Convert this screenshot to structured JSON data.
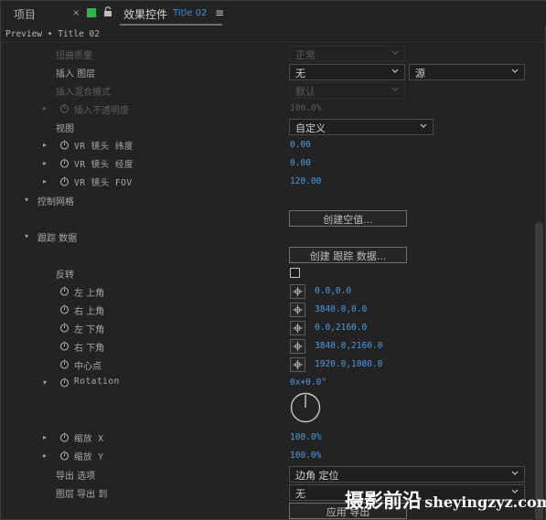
{
  "tabs": {
    "project": "项目",
    "close": "×",
    "effect_controls": "效果控件",
    "effect_controls_sub": "Title 02",
    "menu": "≡"
  },
  "breadcrumb": "Preview • Title 02",
  "props": {
    "distortion_quality": {
      "label": "扭曲质量",
      "value": "正常"
    },
    "inset_layer": {
      "label": "插入 图层",
      "value": "无",
      "source": "源"
    },
    "inset_blend": {
      "label": "插入混合模式",
      "value": "默认"
    },
    "inset_opacity": {
      "label": "插入不透明度",
      "value": "100.0%"
    },
    "view": {
      "label": "视图",
      "value": "自定义"
    },
    "vr_lat": {
      "label": "VR 镜头 纬度",
      "value": "0.00"
    },
    "vr_lon": {
      "label": "VR 镜头 经度",
      "value": "0.00"
    },
    "vr_fov": {
      "label": "VR 镜头 FOV",
      "value": "120.00"
    },
    "control_mesh": {
      "label": "控制网格",
      "button": "创建空值..."
    },
    "tracking_data": {
      "label": "跟踪 数据",
      "button": "创建 跟踪 数据..."
    },
    "invert": {
      "label": "反转"
    },
    "top_left": {
      "label": "左 上角",
      "value": "0.0,0.0"
    },
    "top_right": {
      "label": "右 上角",
      "value": "3840.0,0.0"
    },
    "bottom_left": {
      "label": "左 下角",
      "value": "0.0,2160.0"
    },
    "bottom_right": {
      "label": "右 下角",
      "value": "3840.0,2160.0"
    },
    "center": {
      "label": "中心点",
      "value": "1920.0,1080.0"
    },
    "rotation": {
      "label": "Rotation",
      "value": "0x+0.0°"
    },
    "scale_x": {
      "label": "缩放 X",
      "value": "100.0%"
    },
    "scale_y": {
      "label": "缩放 Y",
      "value": "100.0%"
    },
    "export_options": {
      "label": "导出 选项",
      "value": "边角 定位"
    },
    "layer_export_to": {
      "label": "图层 导出 到",
      "value": "无"
    },
    "apply": {
      "button": "应用 导出"
    }
  },
  "watermark": {
    "cn": "摄影前沿",
    "en": "sheyingzyz.com"
  },
  "colors": {
    "accent": "#4d9be6",
    "label_square": "#2fb64a",
    "background": "#232323"
  }
}
